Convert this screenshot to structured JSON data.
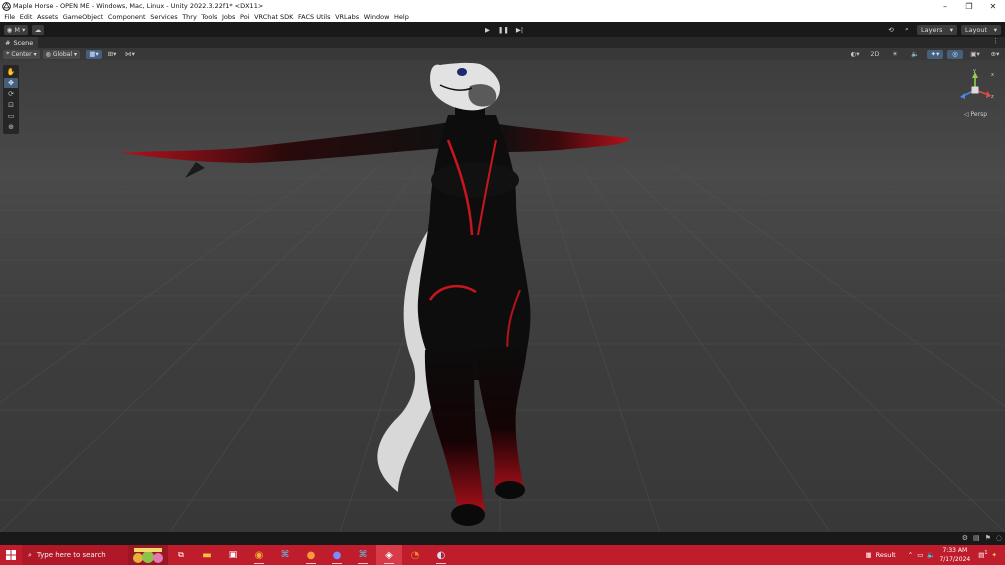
{
  "window": {
    "title": "Maple Horse - OPEN ME - Windows, Mac, Linux - Unity 2022.3.22f1* <DX11>",
    "controls": [
      "–",
      "❐",
      "✕"
    ]
  },
  "menu": [
    "File",
    "Edit",
    "Assets",
    "GameObject",
    "Component",
    "Services",
    "Thry",
    "Tools",
    "Jobs",
    "Poi",
    "VRChat SDK",
    "FACS Utils",
    "VRLabs",
    "Window",
    "Help"
  ],
  "toolbar": {
    "account_label": "M",
    "layers_label": "Layers",
    "layout_label": "Layout"
  },
  "scene": {
    "tab_label": "Scene",
    "pivot_label": "Center",
    "space_label": "Global",
    "mode_2d_label": "2D",
    "persp_label": "Persp",
    "axis_labels": {
      "y": "y",
      "x": "x",
      "z": "z"
    }
  },
  "taskbar": {
    "search_placeholder": "Type here to search",
    "tray_label": "Result",
    "time": "7:33 AM",
    "date": "7/17/2024",
    "notification_count": "1"
  },
  "colors": {
    "accent_blue": "#46607c",
    "taskbar_red": "#c01d2c",
    "toolbar_dark": "#191919",
    "panel": "#383838"
  }
}
